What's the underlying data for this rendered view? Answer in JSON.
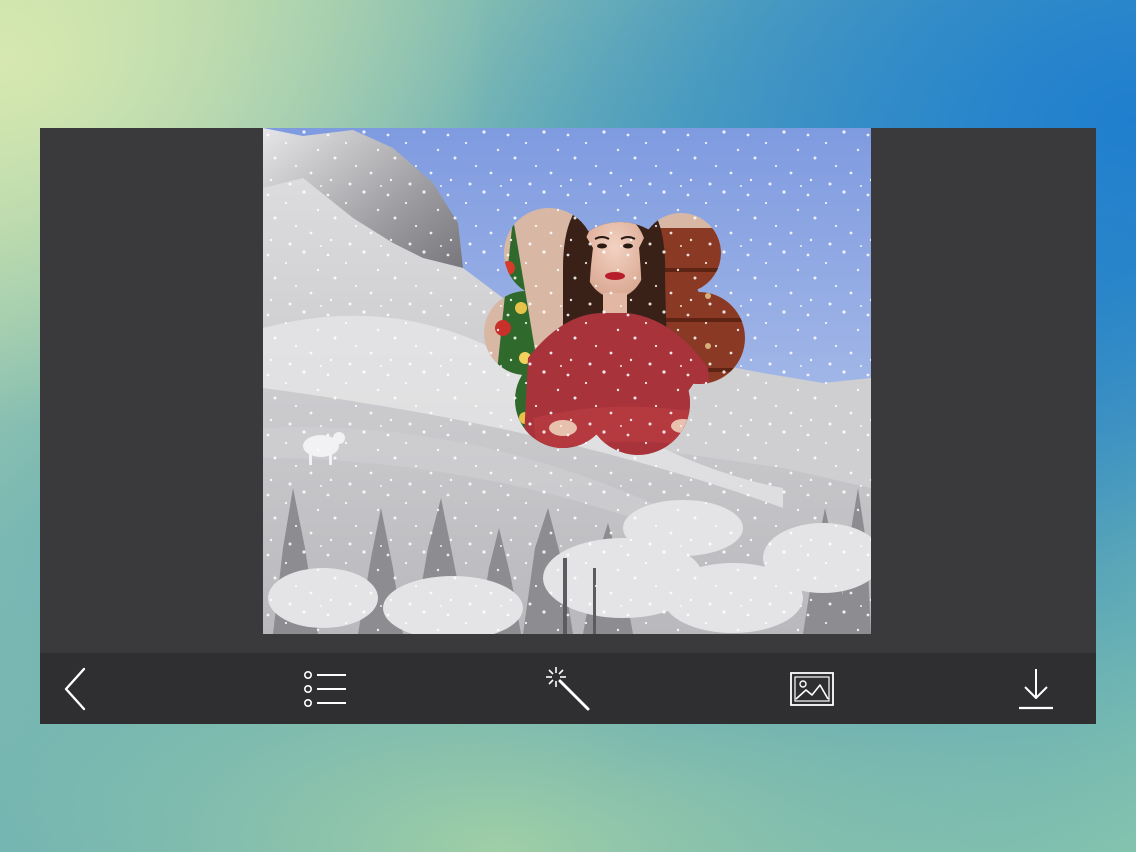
{
  "editor": {
    "photo": {
      "background_scene": "snowy-mountain-scene",
      "portrait_frame_shape": "flower-scalloped-frame",
      "portrait_subject": "woman-in-red-lace-top"
    }
  },
  "toolbar": {
    "items": [
      {
        "icon": "chevron-left-icon",
        "action": "back"
      },
      {
        "icon": "list-icon",
        "action": "frames-list"
      },
      {
        "icon": "magic-wand-icon",
        "action": "effects"
      },
      {
        "icon": "image-icon",
        "action": "choose-photo"
      },
      {
        "icon": "download-icon",
        "action": "save"
      }
    ]
  },
  "colors": {
    "frame_background": "#3a393b",
    "toolbar_background": "#2f2e30",
    "icon_color": "#ffffff",
    "sky": "#8ea8e0",
    "dress_red": "#a8333a"
  }
}
